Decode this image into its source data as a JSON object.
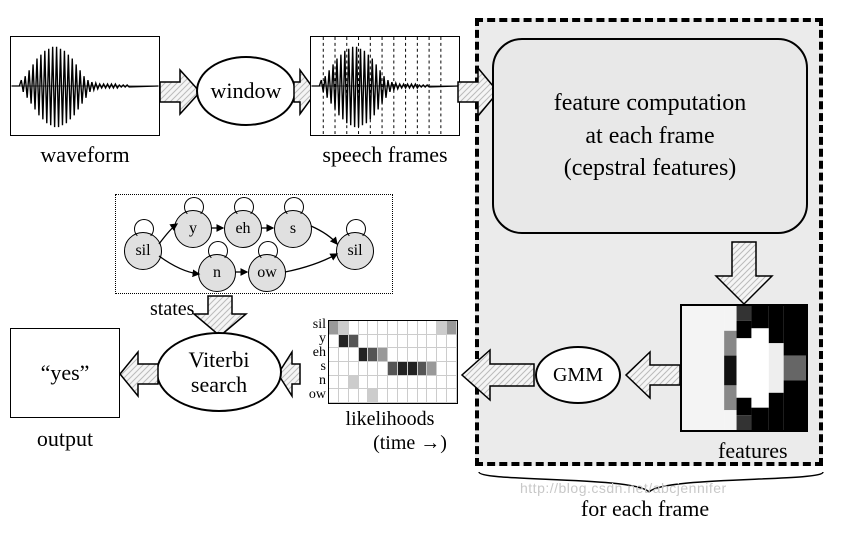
{
  "diagram": {
    "waveform": {
      "label": "waveform"
    },
    "window": {
      "label": "window"
    },
    "frames": {
      "label": "speech frames"
    },
    "feature_box": {
      "line1": "feature computation",
      "line2": "at each frame",
      "line3": "(cepstral features)"
    },
    "features": {
      "label": "features"
    },
    "gmm": {
      "label": "GMM"
    },
    "likelihoods": {
      "row_labels": [
        "sil",
        "y",
        "eh",
        "s",
        "n",
        "ow"
      ],
      "caption1": "likelihoods",
      "caption2": "(time →)"
    },
    "states": {
      "label": "states",
      "nodes": [
        "sil",
        "y",
        "eh",
        "s",
        "sil",
        "n",
        "ow"
      ]
    },
    "viterbi": {
      "line1": "Viterbi",
      "line2": "search"
    },
    "output": {
      "value": "“yes”",
      "label": "output"
    },
    "each_frame": {
      "label": "for each frame"
    },
    "watermark": "http://blog.csdn.net/abcjennifer"
  }
}
